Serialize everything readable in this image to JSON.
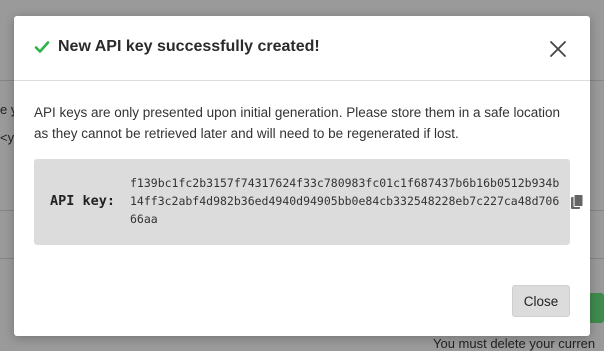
{
  "modal": {
    "title": "New API key successfully created!",
    "description": "API keys are only presented upon initial generation. Please store them in a safe location as they cannot be retrieved later and will need to be regenerated if lost.",
    "key_label": "API key:",
    "key_value": "f139bc1fc2b3157f74317624f33c780983fc01c1f687437b6b16b0512b934b14ff3c2abf4d982b36ed4940d94905bb0e84cb332548228eb7c227ca48d70666aa",
    "close_button": "Close"
  },
  "background": {
    "fragment_1": "e y",
    "fragment_2": "<y",
    "fragment_3": "You must delete your curren"
  },
  "colors": {
    "success": "#2db34a",
    "key_box": "#dcdcdc",
    "overlay": "#6e6e6e"
  }
}
